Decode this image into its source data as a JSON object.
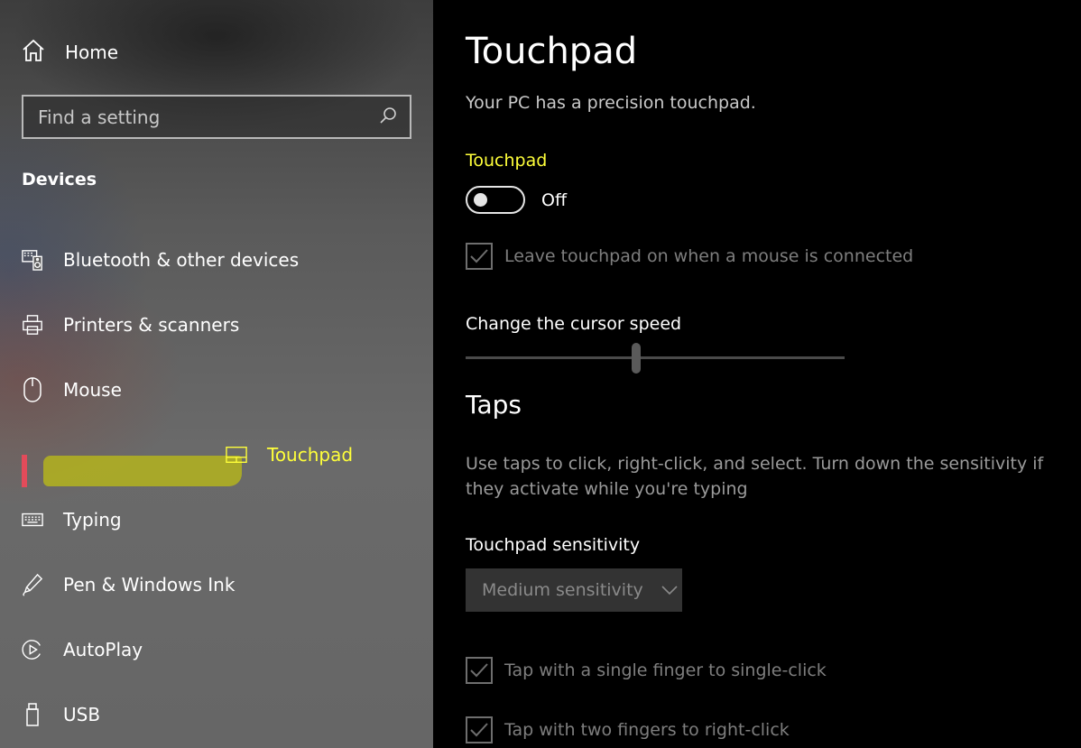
{
  "sidebar": {
    "home_label": "Home",
    "search_placeholder": "Find a setting",
    "section_title": "Devices",
    "items": [
      {
        "label": "Bluetooth & other devices",
        "icon": "bluetooth-devices-icon"
      },
      {
        "label": "Printers & scanners",
        "icon": "printer-icon"
      },
      {
        "label": "Mouse",
        "icon": "mouse-icon"
      },
      {
        "label": "Touchpad",
        "icon": "touchpad-icon",
        "active": true
      },
      {
        "label": "Typing",
        "icon": "keyboard-icon"
      },
      {
        "label": "Pen & Windows Ink",
        "icon": "pen-icon"
      },
      {
        "label": "AutoPlay",
        "icon": "autoplay-icon"
      },
      {
        "label": "USB",
        "icon": "usb-icon"
      }
    ]
  },
  "main": {
    "title": "Touchpad",
    "subtitle": "Your PC has a precision touchpad.",
    "touchpad_label": "Touchpad",
    "toggle_state": "Off",
    "leave_on_label": "Leave touchpad on when a mouse is connected",
    "cursor_speed_label": "Change the cursor speed",
    "cursor_speed_fraction": 0.45,
    "taps_title": "Taps",
    "taps_description": "Use taps to click, right-click, and select. Turn down the sensitivity if they activate while you're typing",
    "sensitivity_label": "Touchpad sensitivity",
    "sensitivity_value": "Medium sensitivity",
    "single_tap_label": "Tap with a single finger to single-click",
    "two_finger_label": "Tap with two fingers to right-click"
  },
  "colors": {
    "accent_highlight": "#ffff3a",
    "active_indicator": "#e24b5a"
  }
}
